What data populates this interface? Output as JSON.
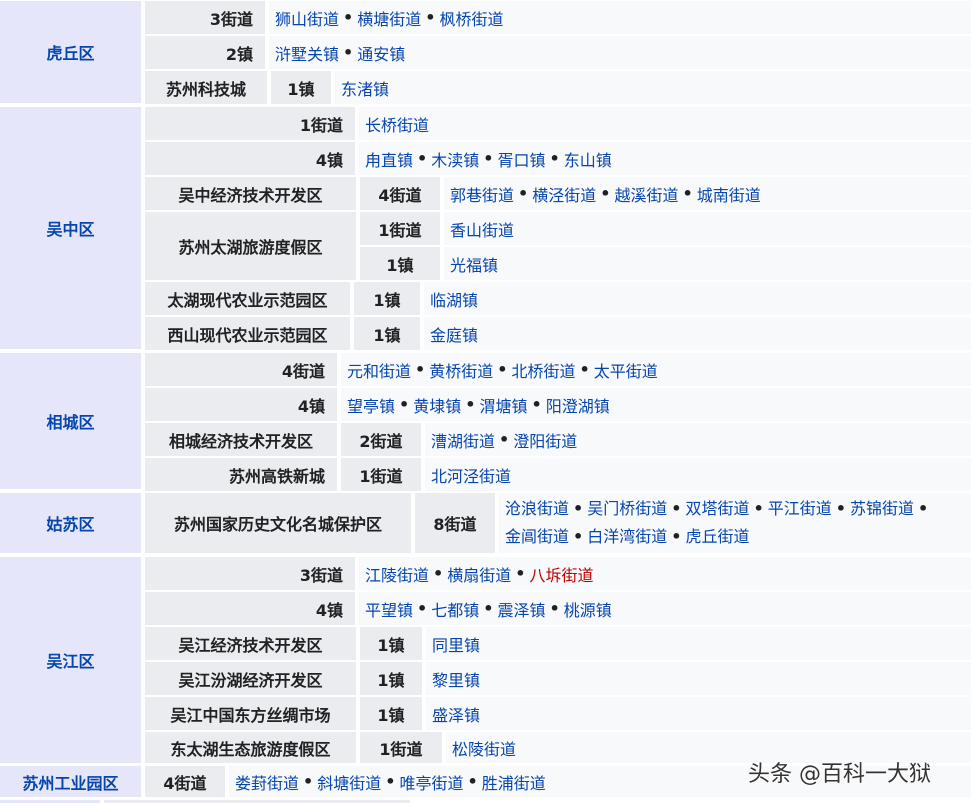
{
  "districts": {
    "huqiu": "虎丘区",
    "wuzhong": "吴中区",
    "xiangcheng": "相城区",
    "gusu": "姑苏区",
    "wujiang": "吴江区",
    "sip": "苏州工业园区"
  },
  "zones": {
    "kejicheng": "苏州科技城",
    "wzjk": "吴中经济技术开发区",
    "taihu": "苏州太湖旅游度假区",
    "thny": "太湖现代农业示范园区",
    "xsny": "西山现代农业示范园区",
    "xcjk": "相城经济技术开发区",
    "gaotie": "苏州高铁新城",
    "lishi": "苏州国家历史文化名城保护区",
    "wjjk": "吴江经济技术开发区",
    "fenhu": "吴江汾湖经济开发区",
    "sichou": "吴江中国东方丝绸市场",
    "dongtaihu": "东太湖生态旅游度假区"
  },
  "counts": {
    "c_3jd": "3街道",
    "c_2z": "2镇",
    "c_1z": "1镇",
    "c_1jd": "1街道",
    "c_4z": "4镇",
    "c_4jd": "4街道",
    "c_2jd": "2街道",
    "c_8jd": "8街道"
  },
  "sep": "•",
  "places": {
    "shishan": "狮山街道",
    "hengtang": "横塘街道",
    "fengqiao": "枫桥街道",
    "xushuguan": "浒墅关镇",
    "tongan": "通安镇",
    "dongzhu": "东渚镇",
    "changqiao": "长桥街道",
    "luzhi": "甪直镇",
    "mudu": "木渎镇",
    "xukou": "胥口镇",
    "dongshan": "东山镇",
    "guoxiang": "郭巷街道",
    "hengjing": "横泾街道",
    "yuexi": "越溪街道",
    "chengnan": "城南街道",
    "xiangshan": "香山街道",
    "guangfu": "光福镇",
    "linhu": "临湖镇",
    "jinting": "金庭镇",
    "yuanhe": "元和街道",
    "huangqiao": "黄桥街道",
    "beiqiao": "北桥街道",
    "taiping": "太平街道",
    "wangting": "望亭镇",
    "huangdai": "黄埭镇",
    "weitang": "渭塘镇",
    "yangchenghu": "阳澄湖镇",
    "caohu": "漕湖街道",
    "chengyang": "澄阳街道",
    "beihejing": "北河泾街道",
    "canglang": "沧浪街道",
    "wumenqiao": "吴门桥街道",
    "shuangta": "双塔街道",
    "pingjiang": "平江街道",
    "sujin": "苏锦街道",
    "jinchang": "金阊街道",
    "baiyangwan": "白洋湾街道",
    "huqiujd": "虎丘街道",
    "jiangling": "江陵街道",
    "hengshan": "横扇街道",
    "bachai": "八坼街道",
    "pingwang": "平望镇",
    "qidu": "七都镇",
    "zhenze": "震泽镇",
    "taoyuan": "桃源镇",
    "tongli": "同里镇",
    "lili": "黎里镇",
    "shengze": "盛泽镇",
    "songling": "松陵街道",
    "loufeng": "娄葑街道",
    "xietang": "斜塘街道",
    "weiting": "唯亭街道",
    "shengpu": "胜浦街道"
  },
  "watermark": "头条 @百科一大狱"
}
